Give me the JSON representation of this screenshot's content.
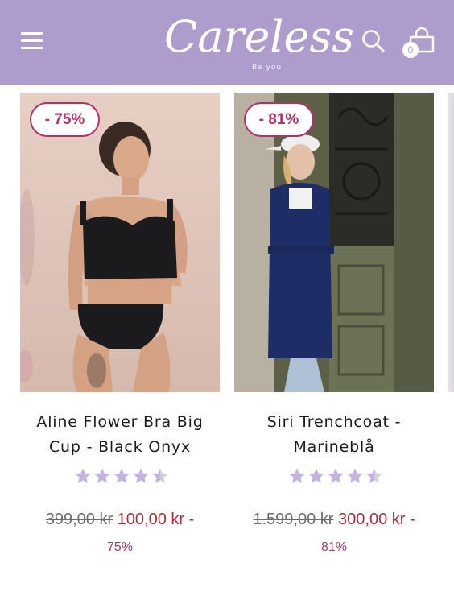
{
  "header": {
    "logo_text": "Careless",
    "logo_tagline": "Be you",
    "cart_count": "0",
    "background_color": "#ae9ccd",
    "icons": [
      "hamburger-menu-icon",
      "search-icon",
      "shopping-bag-icon"
    ]
  },
  "products": [
    {
      "discount_badge": "- 75%",
      "title_line1": "Aline Flower Bra Big",
      "title_line2": "Cup - Black Onyx",
      "rating": 4.5,
      "old_price": "399,00 kr",
      "new_price": "100,00 kr",
      "dash": " -",
      "discount_percent": "75%"
    },
    {
      "discount_badge": "- 81%",
      "title_line1": "Siri Trenchcoat -",
      "title_line2": "Marineblå",
      "rating": 4.5,
      "old_price": "1.599,00 kr",
      "new_price": "300,00 kr",
      "dash": " -",
      "discount_percent": "81%"
    }
  ],
  "colors": {
    "accent": "#b5306b",
    "sale_price": "#b22a3a",
    "star": "#c3b3df"
  }
}
